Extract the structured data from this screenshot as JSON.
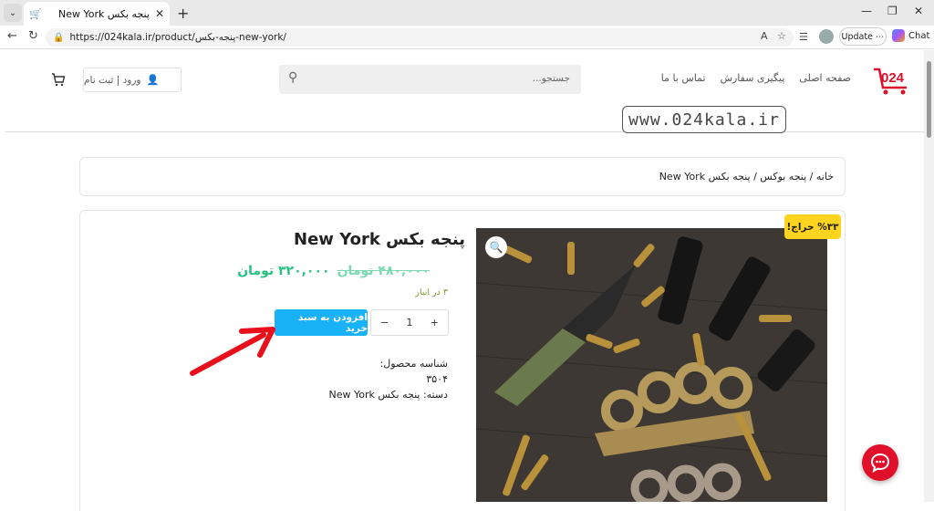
{
  "browser": {
    "tab_title": "پنجه بکس New York",
    "url": "https://024kala.ir/product/پنجه-بکس-new-york/",
    "update_label": "Update",
    "chat_label": "Chat"
  },
  "header": {
    "nav": [
      "صفحه اصلی",
      "پیگیری سفارش",
      "تماس با ما"
    ],
    "search_placeholder": "جستجو...",
    "login_label": "ورود | ثبت نام"
  },
  "watermark": "www.024kala.ir",
  "breadcrumb": "خانه / پنجه بوکس / پنجه بکس New York",
  "product": {
    "sale_badge": "%۳۳ حراج!",
    "title": "پنجه بکس New York",
    "old_price": "۴۸۰,۰۰۰ تومان",
    "new_price": "۳۲۰,۰۰۰ تومان",
    "stock": "۳ در انبار",
    "qty_value": "1",
    "qty_minus": "−",
    "qty_plus": "+",
    "add_to_cart": "افزودن به سبد خرید",
    "sku_label": "شناسه محصول:",
    "sku_value": "۳۵۰۴",
    "category": "دسته: پنجه بکس New York"
  },
  "colors": {
    "accent": "#1ab2f7",
    "price": "#26c281",
    "badge": "#ffd41f",
    "brand_red": "#e0102a"
  }
}
